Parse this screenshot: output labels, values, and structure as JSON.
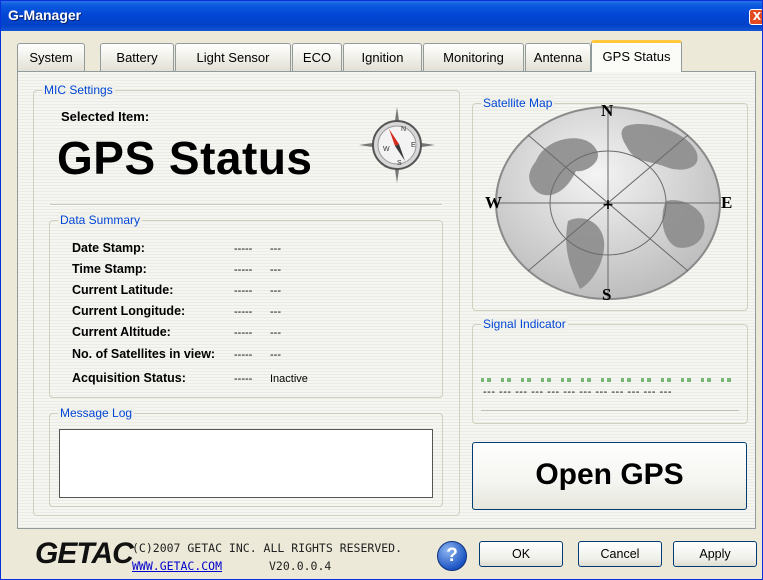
{
  "window": {
    "title": "G-Manager",
    "close_glyph": "X"
  },
  "tabs": [
    {
      "label": "System"
    },
    {
      "label": "Battery"
    },
    {
      "label": "Light Sensor"
    },
    {
      "label": "ECO"
    },
    {
      "label": "Ignition"
    },
    {
      "label": "Monitoring"
    },
    {
      "label": "Antenna"
    },
    {
      "label": "GPS Status",
      "active": true
    }
  ],
  "mic": {
    "legend": "MIC Settings",
    "selected_label": "Selected Item:",
    "selected_value": "GPS Status",
    "icon": "compass-icon"
  },
  "summary": {
    "legend": "Data Summary",
    "rows": [
      {
        "label": "Date Stamp:",
        "dash": "-----",
        "value": "---"
      },
      {
        "label": "Time Stamp:",
        "dash": "-----",
        "value": "---"
      },
      {
        "label": "Current Latitude:",
        "dash": "-----",
        "value": "---"
      },
      {
        "label": "Current Longitude:",
        "dash": "-----",
        "value": "---"
      },
      {
        "label": "Current Altitude:",
        "dash": "-----",
        "value": "---"
      },
      {
        "label": "No. of Satellites in view:",
        "dash": "-----",
        "value": "---"
      },
      {
        "label": "Acquisition Status:",
        "dash": "-----",
        "value": "Inactive"
      }
    ]
  },
  "log": {
    "legend": "Message Log",
    "content": ""
  },
  "satellite": {
    "legend": "Satellite Map",
    "north": "N",
    "south": "S",
    "east": "E",
    "west": "W"
  },
  "signal": {
    "legend": "Signal Indicator",
    "bars": "--- --- --- --- --- --- --- --- --- --- --- ---"
  },
  "open_gps_label": "Open GPS",
  "footer": {
    "logo": "GETAC",
    "copyright": "(C)2007 GETAC INC. ALL RIGHTS RESERVED.",
    "link": "WWW.GETAC.COM",
    "version": "V20.0.0.4",
    "help_glyph": "?",
    "ok": "OK",
    "cancel": "Cancel",
    "apply": "Apply"
  },
  "colors": {
    "titlebar": "#0346d6",
    "legend_text": "#0046d5",
    "active_tab_accent": "#ffc73c",
    "link": "#0000cc"
  }
}
